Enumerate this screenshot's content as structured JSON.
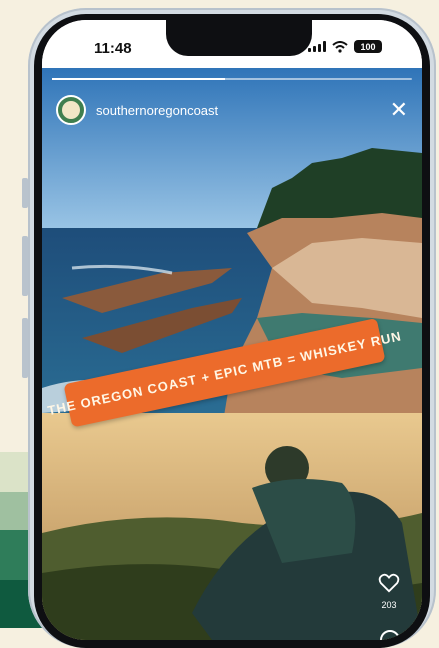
{
  "status_bar": {
    "time": "11:48",
    "battery": "100"
  },
  "story": {
    "username": "southernoregoncoast",
    "progress": 0.48,
    "banner_text": "THE OREGON COAST + EPIC MTB = WHISKEY RUN",
    "like_count": "203"
  },
  "icons": [
    "signal-icon",
    "wifi-icon",
    "battery-icon",
    "close-icon",
    "heart-icon",
    "comment-icon"
  ],
  "colors": {
    "banner": "#ec6b2b",
    "background": "#f6f0e0"
  }
}
